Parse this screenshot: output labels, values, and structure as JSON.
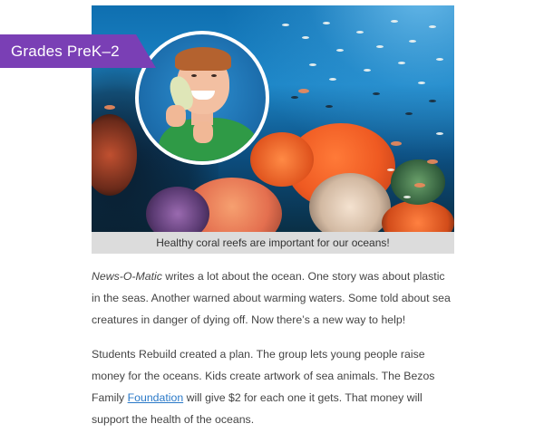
{
  "banner": {
    "grade_label": "Grades PreK–2",
    "color": "#7a3fb5"
  },
  "hero": {
    "description_icon": "coral-reef-photo",
    "portrait_icon": "boy-holding-toy-photo"
  },
  "caption": {
    "text": "Healthy coral reefs are important for our oceans!"
  },
  "article": {
    "p1": {
      "publication": "News-O-Matic",
      "rest": " writes a lot about the ocean. One story was about plastic in the seas. Another warned about warming waters. Some told about sea creatures in danger of dying off. Now there’s a new way to help!"
    },
    "p2": {
      "before_link": "Students Rebuild created a plan. The group lets young people raise money for the oceans. Kids create artwork of sea animals. The Bezos Family ",
      "link_text": "Foundation",
      "after_link": " will give $2 for each one it gets. That money will support the health of the oceans."
    },
    "link_color": "#2a79c8"
  }
}
